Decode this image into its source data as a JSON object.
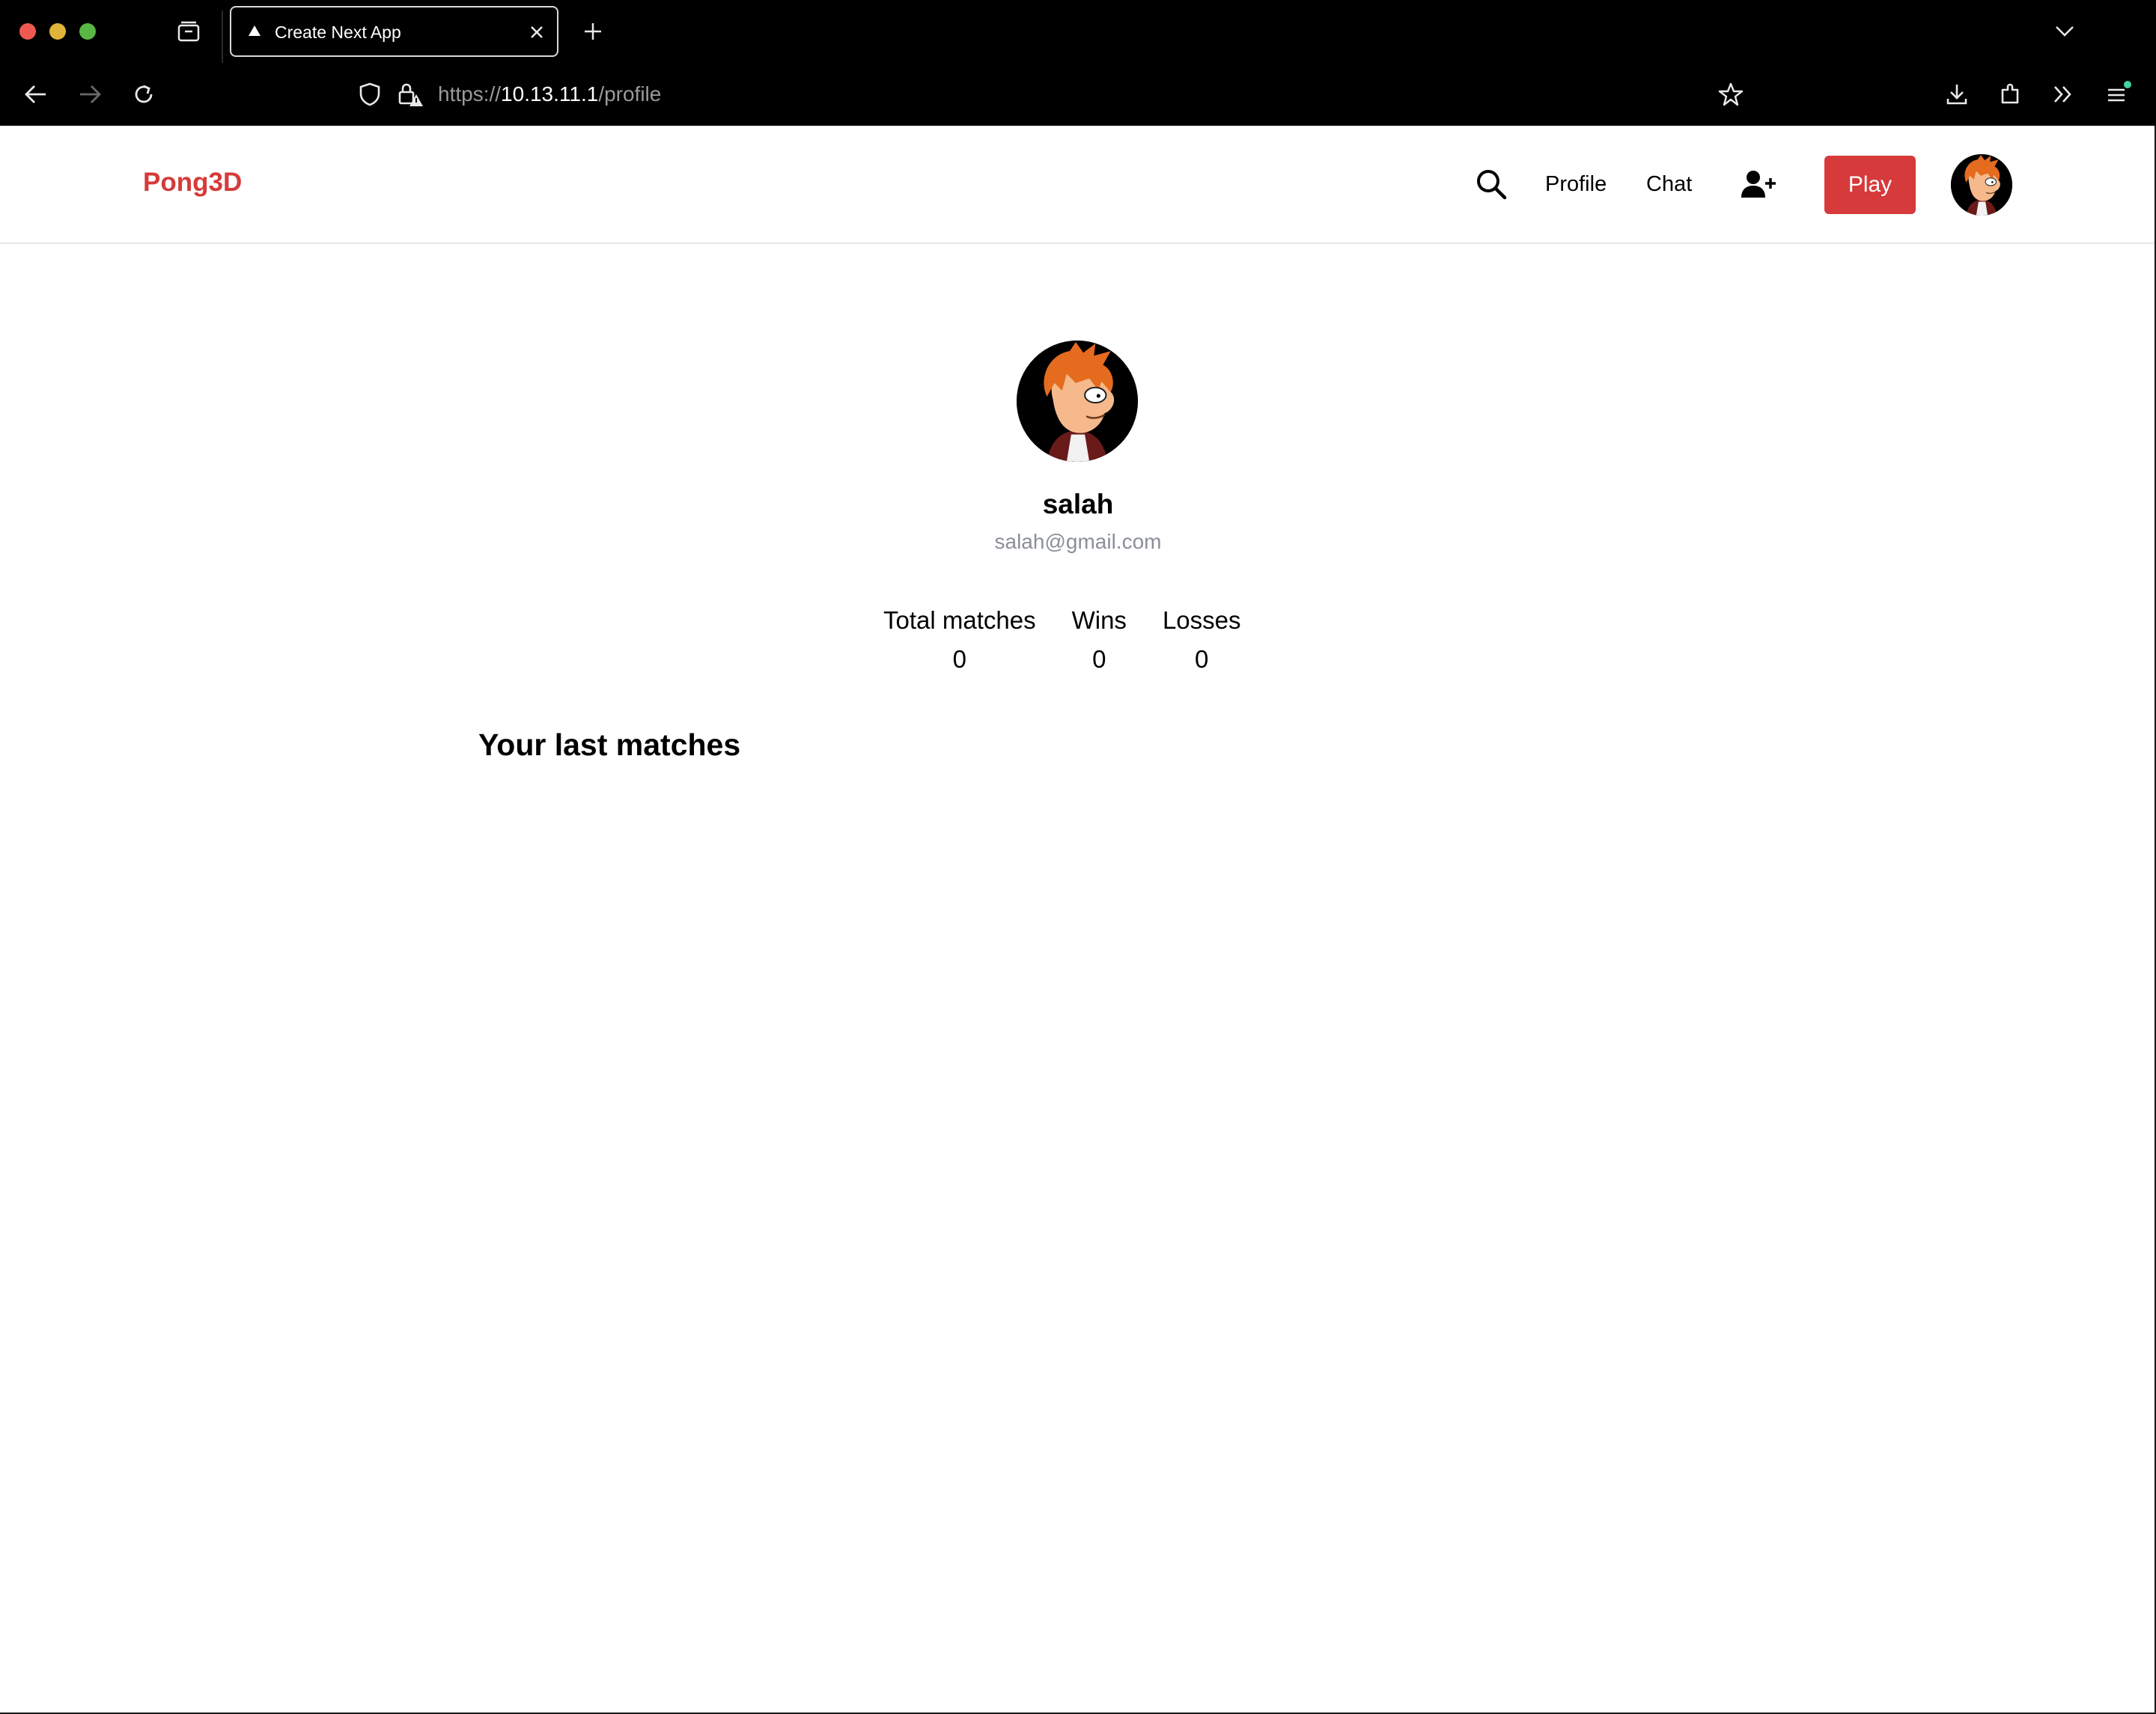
{
  "browser": {
    "tab_title": "Create Next App",
    "url_scheme": "https://",
    "url_host": "10.13.11.1",
    "url_path": "/profile"
  },
  "header": {
    "brand": "Pong3D",
    "nav_profile": "Profile",
    "nav_chat": "Chat",
    "play_label": "Play",
    "accent_color": "#d63a3a"
  },
  "profile": {
    "username": "salah",
    "email": "salah@gmail.com",
    "stats": [
      {
        "label": "Total matches",
        "value": "0"
      },
      {
        "label": "Wins",
        "value": "0"
      },
      {
        "label": "Losses",
        "value": "0"
      }
    ],
    "section_title": "Your last matches"
  },
  "icons": {
    "search": "search-icon",
    "add_friend": "user-plus-icon"
  }
}
